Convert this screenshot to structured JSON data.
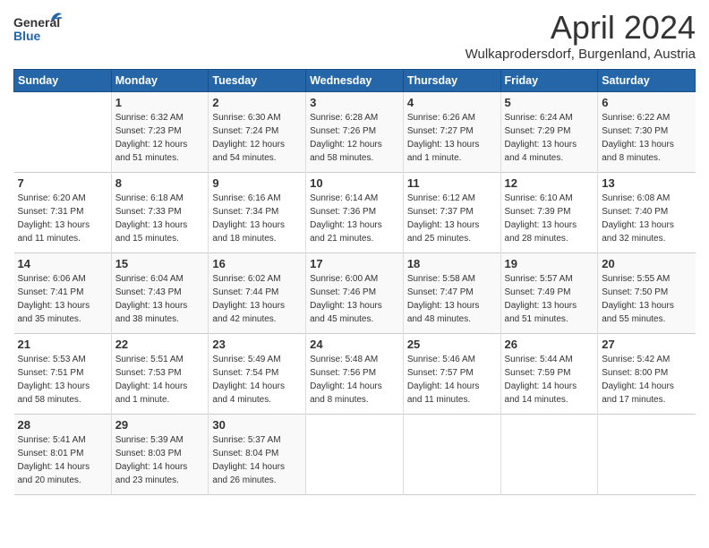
{
  "header": {
    "logo_general": "General",
    "logo_blue": "Blue",
    "month_title": "April 2024",
    "subtitle": "Wulkaprodersdorf, Burgenland, Austria"
  },
  "weekdays": [
    "Sunday",
    "Monday",
    "Tuesday",
    "Wednesday",
    "Thursday",
    "Friday",
    "Saturday"
  ],
  "weeks": [
    [
      {
        "day": "",
        "info": ""
      },
      {
        "day": "1",
        "info": "Sunrise: 6:32 AM\nSunset: 7:23 PM\nDaylight: 12 hours\nand 51 minutes."
      },
      {
        "day": "2",
        "info": "Sunrise: 6:30 AM\nSunset: 7:24 PM\nDaylight: 12 hours\nand 54 minutes."
      },
      {
        "day": "3",
        "info": "Sunrise: 6:28 AM\nSunset: 7:26 PM\nDaylight: 12 hours\nand 58 minutes."
      },
      {
        "day": "4",
        "info": "Sunrise: 6:26 AM\nSunset: 7:27 PM\nDaylight: 13 hours\nand 1 minute."
      },
      {
        "day": "5",
        "info": "Sunrise: 6:24 AM\nSunset: 7:29 PM\nDaylight: 13 hours\nand 4 minutes."
      },
      {
        "day": "6",
        "info": "Sunrise: 6:22 AM\nSunset: 7:30 PM\nDaylight: 13 hours\nand 8 minutes."
      }
    ],
    [
      {
        "day": "7",
        "info": "Sunrise: 6:20 AM\nSunset: 7:31 PM\nDaylight: 13 hours\nand 11 minutes."
      },
      {
        "day": "8",
        "info": "Sunrise: 6:18 AM\nSunset: 7:33 PM\nDaylight: 13 hours\nand 15 minutes."
      },
      {
        "day": "9",
        "info": "Sunrise: 6:16 AM\nSunset: 7:34 PM\nDaylight: 13 hours\nand 18 minutes."
      },
      {
        "day": "10",
        "info": "Sunrise: 6:14 AM\nSunset: 7:36 PM\nDaylight: 13 hours\nand 21 minutes."
      },
      {
        "day": "11",
        "info": "Sunrise: 6:12 AM\nSunset: 7:37 PM\nDaylight: 13 hours\nand 25 minutes."
      },
      {
        "day": "12",
        "info": "Sunrise: 6:10 AM\nSunset: 7:39 PM\nDaylight: 13 hours\nand 28 minutes."
      },
      {
        "day": "13",
        "info": "Sunrise: 6:08 AM\nSunset: 7:40 PM\nDaylight: 13 hours\nand 32 minutes."
      }
    ],
    [
      {
        "day": "14",
        "info": "Sunrise: 6:06 AM\nSunset: 7:41 PM\nDaylight: 13 hours\nand 35 minutes."
      },
      {
        "day": "15",
        "info": "Sunrise: 6:04 AM\nSunset: 7:43 PM\nDaylight: 13 hours\nand 38 minutes."
      },
      {
        "day": "16",
        "info": "Sunrise: 6:02 AM\nSunset: 7:44 PM\nDaylight: 13 hours\nand 42 minutes."
      },
      {
        "day": "17",
        "info": "Sunrise: 6:00 AM\nSunset: 7:46 PM\nDaylight: 13 hours\nand 45 minutes."
      },
      {
        "day": "18",
        "info": "Sunrise: 5:58 AM\nSunset: 7:47 PM\nDaylight: 13 hours\nand 48 minutes."
      },
      {
        "day": "19",
        "info": "Sunrise: 5:57 AM\nSunset: 7:49 PM\nDaylight: 13 hours\nand 51 minutes."
      },
      {
        "day": "20",
        "info": "Sunrise: 5:55 AM\nSunset: 7:50 PM\nDaylight: 13 hours\nand 55 minutes."
      }
    ],
    [
      {
        "day": "21",
        "info": "Sunrise: 5:53 AM\nSunset: 7:51 PM\nDaylight: 13 hours\nand 58 minutes."
      },
      {
        "day": "22",
        "info": "Sunrise: 5:51 AM\nSunset: 7:53 PM\nDaylight: 14 hours\nand 1 minute."
      },
      {
        "day": "23",
        "info": "Sunrise: 5:49 AM\nSunset: 7:54 PM\nDaylight: 14 hours\nand 4 minutes."
      },
      {
        "day": "24",
        "info": "Sunrise: 5:48 AM\nSunset: 7:56 PM\nDaylight: 14 hours\nand 8 minutes."
      },
      {
        "day": "25",
        "info": "Sunrise: 5:46 AM\nSunset: 7:57 PM\nDaylight: 14 hours\nand 11 minutes."
      },
      {
        "day": "26",
        "info": "Sunrise: 5:44 AM\nSunset: 7:59 PM\nDaylight: 14 hours\nand 14 minutes."
      },
      {
        "day": "27",
        "info": "Sunrise: 5:42 AM\nSunset: 8:00 PM\nDaylight: 14 hours\nand 17 minutes."
      }
    ],
    [
      {
        "day": "28",
        "info": "Sunrise: 5:41 AM\nSunset: 8:01 PM\nDaylight: 14 hours\nand 20 minutes."
      },
      {
        "day": "29",
        "info": "Sunrise: 5:39 AM\nSunset: 8:03 PM\nDaylight: 14 hours\nand 23 minutes."
      },
      {
        "day": "30",
        "info": "Sunrise: 5:37 AM\nSunset: 8:04 PM\nDaylight: 14 hours\nand 26 minutes."
      },
      {
        "day": "",
        "info": ""
      },
      {
        "day": "",
        "info": ""
      },
      {
        "day": "",
        "info": ""
      },
      {
        "day": "",
        "info": ""
      }
    ]
  ]
}
